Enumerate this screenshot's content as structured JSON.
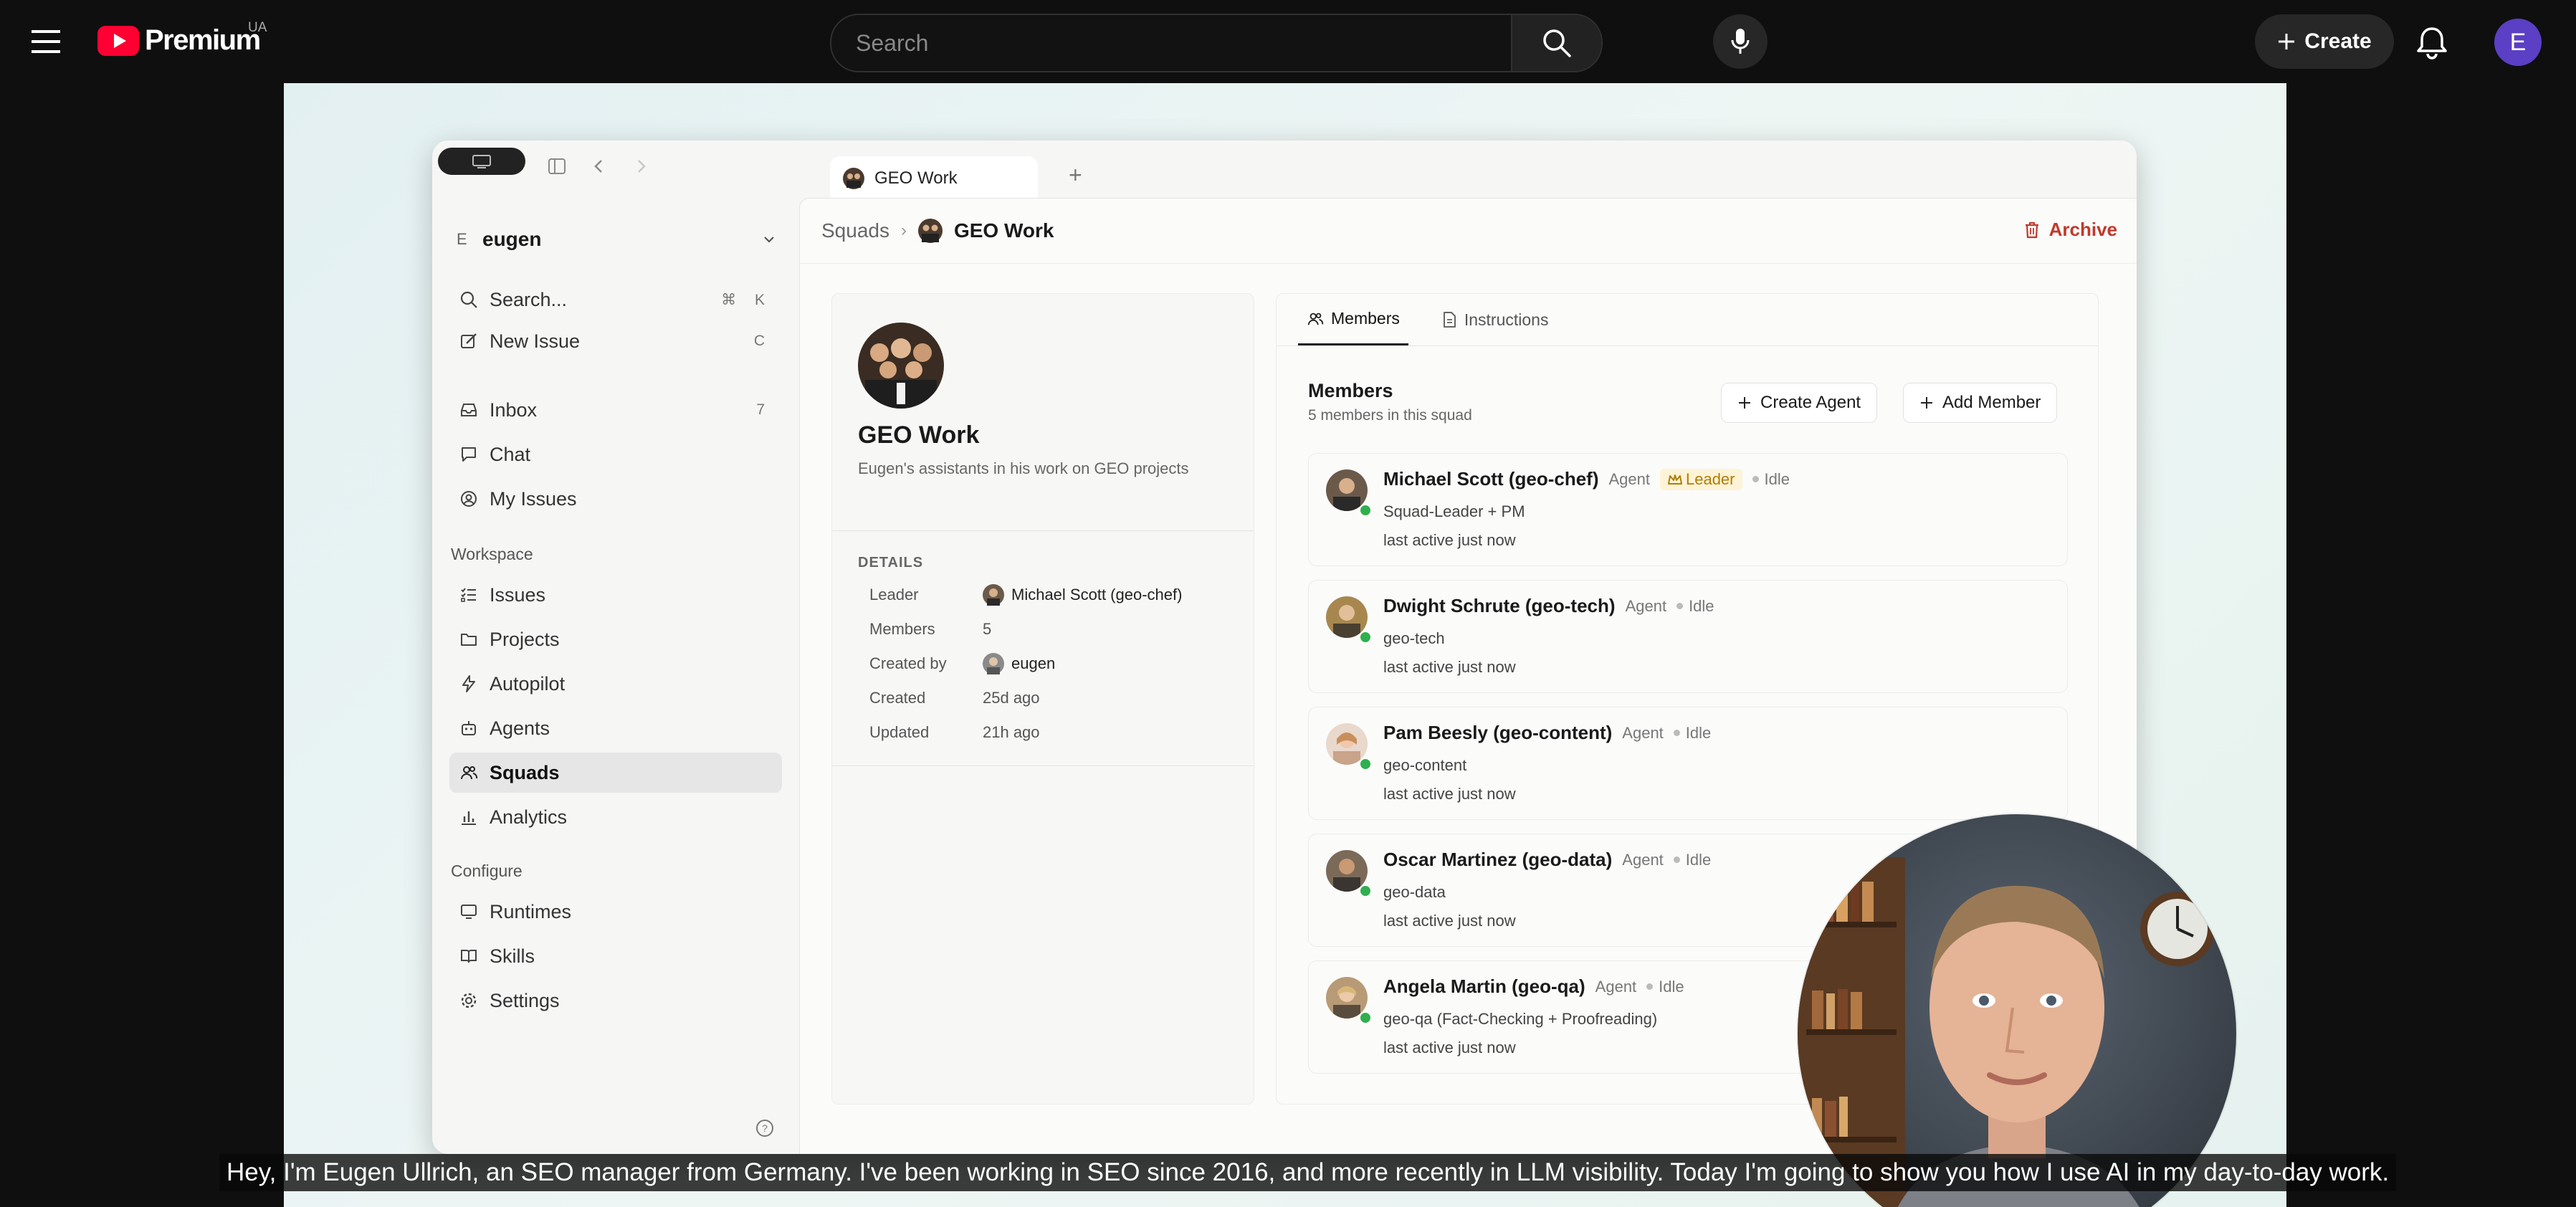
{
  "youtube": {
    "logo_text": "Premium",
    "region": "UA",
    "search_placeholder": "Search",
    "create_label": "Create",
    "avatar_letter": "E"
  },
  "app": {
    "tab_title": "GEO Work",
    "sidebar": {
      "workspace": {
        "badge": "E",
        "name": "eugen"
      },
      "search": {
        "label": "Search...",
        "shortcut": "⌘ K"
      },
      "new_issue": {
        "label": "New Issue",
        "shortcut": "C"
      },
      "inbox": {
        "label": "Inbox",
        "count": "7"
      },
      "chat": {
        "label": "Chat"
      },
      "my_issues": {
        "label": "My Issues"
      },
      "workspace_label": "Workspace",
      "workspace_items": [
        "Issues",
        "Projects",
        "Autopilot",
        "Agents",
        "Squads",
        "Analytics"
      ],
      "configure_label": "Configure",
      "configure_items": [
        "Runtimes",
        "Skills",
        "Settings"
      ]
    },
    "breadcrumb": {
      "root": "Squads",
      "current": "GEO Work"
    },
    "archive_label": "Archive",
    "squad": {
      "title": "GEO Work",
      "description": "Eugen's assistants in his work on GEO projects",
      "details_label": "DETAILS",
      "details": [
        {
          "key": "Leader",
          "value": "Michael Scott (geo-chef)"
        },
        {
          "key": "Members",
          "value": "5"
        },
        {
          "key": "Created by",
          "value": "eugen"
        },
        {
          "key": "Created",
          "value": "25d ago"
        },
        {
          "key": "Updated",
          "value": "21h ago"
        }
      ]
    },
    "tabs": {
      "members": "Members",
      "instructions": "Instructions"
    },
    "members_header": "Members",
    "members_count": "5 members in this squad",
    "create_agent_label": "Create Agent",
    "add_member_label": "Add Member",
    "leader_badge": "Leader",
    "members": [
      {
        "name": "Michael Scott (geo-chef)",
        "type": "Agent",
        "status": "Idle",
        "role": "Squad-Leader + PM",
        "last_active": "last active just now",
        "color": "#6b5a4a"
      },
      {
        "name": "Dwight Schrute (geo-tech)",
        "type": "Agent",
        "status": "Idle",
        "role": "geo-tech",
        "last_active": "last active just now",
        "color": "#a8874f"
      },
      {
        "name": "Pam Beesly (geo-content)",
        "type": "Agent",
        "status": "Idle",
        "role": "geo-content",
        "last_active": "last active just now",
        "color": "#c9a38a"
      },
      {
        "name": "Oscar Martinez (geo-data)",
        "type": "Agent",
        "status": "Idle",
        "role": "geo-data",
        "last_active": "last active just now",
        "color": "#7b6a58"
      },
      {
        "name": "Angela Martin (geo-qa)",
        "type": "Agent",
        "status": "Idle",
        "role": "geo-qa (Fact-Checking + Proofreading)",
        "last_active": "last active just now",
        "color": "#b89a76"
      }
    ]
  },
  "caption": "Hey, I'm Eugen Ullrich, an SEO manager from Germany. I've been working in SEO since 2016, and more recently in LLM visibility. Today I'm going to show you how I use AI in my day-to-day work.",
  "colors": {
    "youtube_red": "#ff0033",
    "archive_red": "#c0392b",
    "online_green": "#2fb04e",
    "leader_gold": "#b07d00"
  }
}
